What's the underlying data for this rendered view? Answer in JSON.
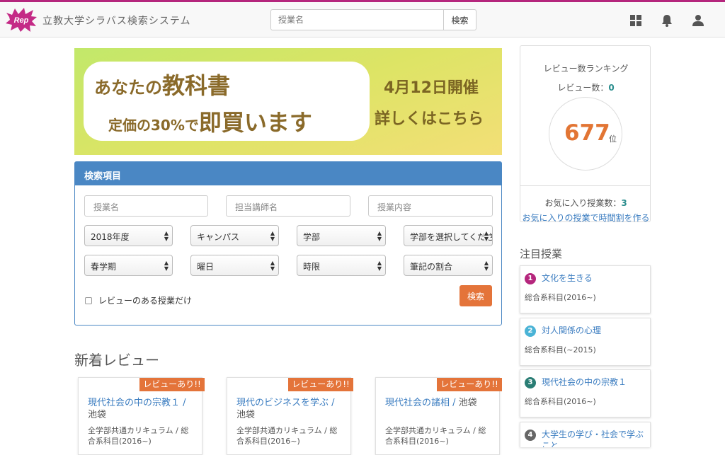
{
  "header": {
    "brand": "立教大学シラバス検索システム",
    "logo_text": "Rep",
    "search_placeholder": "授業名",
    "search_button": "検索",
    "icons": [
      "grid-icon",
      "bell-icon",
      "user-icon"
    ]
  },
  "banner": {
    "line1_prefix": "あなたの",
    "line1_big": "教科書",
    "line2_prefix": "定価の30%で",
    "line2_big": "即買います",
    "event_date": "4月12日開催",
    "details": "詳しくはこちら"
  },
  "search_panel": {
    "title": "検索項目",
    "course_name_placeholder": "授業名",
    "instructor_placeholder": "担当講師名",
    "content_placeholder": "授業内容",
    "year": "2018年度",
    "campus": "キャンパス",
    "faculty": "学部",
    "department": "学部を選択してください",
    "semester": "春学期",
    "day": "曜日",
    "period": "時限",
    "note_ratio": "筆記の割合",
    "review_only_label": "レビューのある授業だけ",
    "search_button": "検索"
  },
  "new_reviews": {
    "title": "新着レビュー",
    "ribbon": "レビューあり!!",
    "cards": [
      {
        "title": "現代社会の中の宗教１",
        "campus": "池袋",
        "category": "全学部共通カリキュラム / 総合系科目(2016~)"
      },
      {
        "title": "現代のビジネスを学ぶ",
        "campus": "池袋",
        "category": "全学部共通カリキュラム / 総合系科目(2016~)"
      },
      {
        "title": "現代社会の諸相",
        "campus": "池袋",
        "category": "全学部共通カリキュラム / 総合系科目(2016~)"
      }
    ]
  },
  "ranking": {
    "title": "レビュー数ランキング",
    "review_count_label": "レビュー数：",
    "review_count": "0",
    "rank": "677",
    "rank_unit": "位",
    "favorites_label": "お気に入り授業数：",
    "favorites_count": "3",
    "favorites_link": "お気に入りの授業で時間割を作る"
  },
  "featured": {
    "title": "注目授業",
    "colors": [
      "#b5267d",
      "#4ab3d6",
      "#2a7d74",
      "#666666"
    ],
    "items": [
      {
        "num": "1",
        "name": "文化を生きる",
        "category": "総合系科目(2016~)"
      },
      {
        "num": "2",
        "name": "対人関係の心理",
        "category": "総合系科目(~2015)"
      },
      {
        "num": "3",
        "name": "現代社会の中の宗教１",
        "category": "総合系科目(2016~)"
      },
      {
        "num": "4",
        "name": "大学生の学び・社会で学ぶこと",
        "category": ""
      }
    ]
  }
}
